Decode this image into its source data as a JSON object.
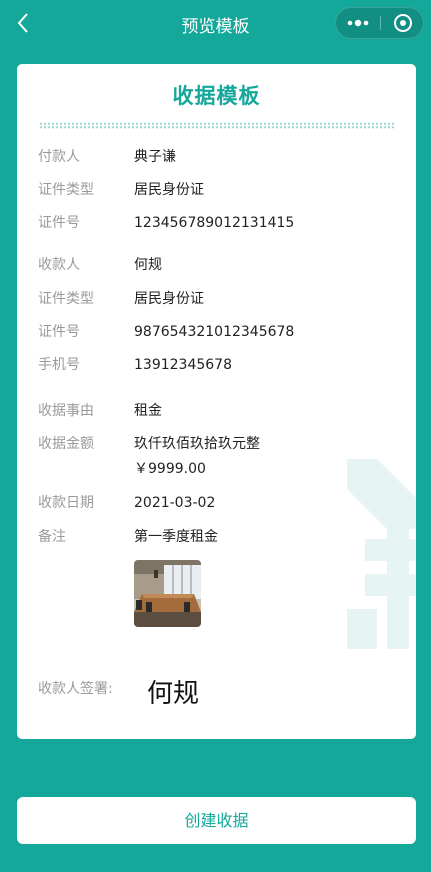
{
  "nav": {
    "title": "预览模板"
  },
  "card": {
    "title": "收据模板",
    "payer": {
      "label": "付款人",
      "value": "典子谦"
    },
    "payer_id_type": {
      "label": "证件类型",
      "value": "居民身份证"
    },
    "payer_id_no": {
      "label": "证件号",
      "value": "123456789012131415"
    },
    "payee": {
      "label": "收款人",
      "value": "何规"
    },
    "payee_id_type": {
      "label": "证件类型",
      "value": "居民身份证"
    },
    "payee_id_no": {
      "label": "证件号",
      "value": "987654321012345678"
    },
    "phone": {
      "label": "手机号",
      "value": "13912345678"
    },
    "reason": {
      "label": "收据事由",
      "value": "租金"
    },
    "amount": {
      "label": "收据金额",
      "value_text": "玖仟玖佰玖拾玖元整",
      "value_num": "￥9999.00"
    },
    "date": {
      "label": "收款日期",
      "value": "2021-03-02"
    },
    "note": {
      "label": "备注",
      "value": "第一季度租金"
    },
    "signature": {
      "label": "收款人签署:",
      "value": "何规"
    }
  },
  "actions": {
    "create_label": "创建收据"
  },
  "colors": {
    "brand": "#14a89b",
    "label": "#9a9a9a",
    "text": "#222222"
  }
}
